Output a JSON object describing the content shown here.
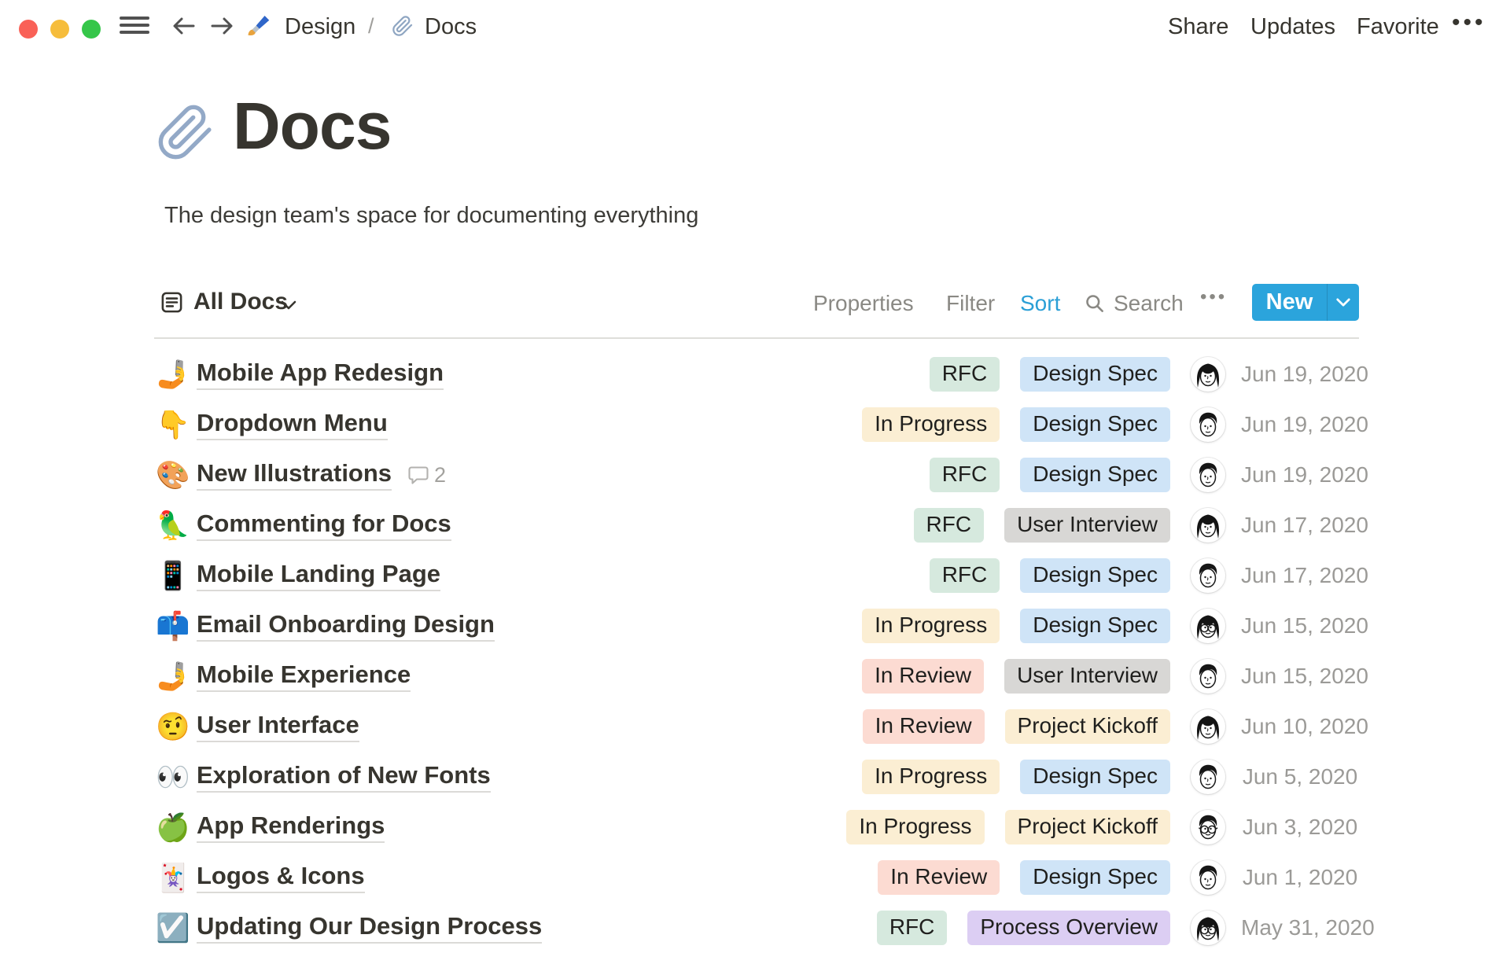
{
  "topbar": {
    "breadcrumb": [
      {
        "icon": "paintbrush-icon",
        "emoji": "🖌️",
        "label": "Design"
      },
      {
        "icon": "paperclip-icon",
        "emoji": "📎",
        "label": "Docs"
      }
    ],
    "separator": "/",
    "actions": [
      "Share",
      "Updates",
      "Favorite"
    ],
    "more_label": "•••"
  },
  "page": {
    "icon": "paperclip-icon",
    "icon_emoji": "📎",
    "title": "Docs",
    "subtitle": "The design team's space for documenting everything"
  },
  "toolbar": {
    "view_icon": "list-view-icon",
    "view_label": "All Docs",
    "properties_label": "Properties",
    "filter_label": "Filter",
    "sort_label": "Sort",
    "active_item": "Sort",
    "search_label": "Search",
    "more_label": "•••",
    "new_label": "New"
  },
  "colors": {
    "accent_blue": "#2BA4DC",
    "tag_green": "#d6e9de",
    "tag_blue": "#cfe4f7",
    "tag_yellow": "#fbeed3",
    "tag_gray": "#d8d7d5",
    "tag_red": "#fcdbd2",
    "tag_purple": "#dccef3"
  },
  "tag_styles": {
    "RFC": "green",
    "In Progress": "yellow",
    "In Review": "red",
    "Design Spec": "blue",
    "User Interview": "gray",
    "Project Kickoff": "yellow",
    "Process Overview": "purple"
  },
  "rows": [
    {
      "emoji": "🤳",
      "title": "Mobile App Redesign",
      "comments": null,
      "status": "RFC",
      "category": "Design Spec",
      "avatar": "woman",
      "date": "Jun 19, 2020"
    },
    {
      "emoji": "👇",
      "title": "Dropdown Menu",
      "comments": null,
      "status": "In Progress",
      "category": "Design Spec",
      "avatar": "man",
      "date": "Jun 19, 2020"
    },
    {
      "emoji": "🎨",
      "title": "New Illustrations",
      "comments": 2,
      "status": "RFC",
      "category": "Design Spec",
      "avatar": "man",
      "date": "Jun 19, 2020"
    },
    {
      "emoji": "🦜",
      "title": "Commenting for Docs",
      "comments": null,
      "status": "RFC",
      "category": "User Interview",
      "avatar": "woman",
      "date": "Jun 17, 2020"
    },
    {
      "emoji": "📱",
      "title": "Mobile Landing Page",
      "comments": null,
      "status": "RFC",
      "category": "Design Spec",
      "avatar": "man",
      "date": "Jun 17, 2020"
    },
    {
      "emoji": "📫",
      "title": "Email Onboarding Design",
      "comments": null,
      "status": "In Progress",
      "category": "Design Spec",
      "avatar": "woman-glasses",
      "date": "Jun 15, 2020"
    },
    {
      "emoji": "🤳",
      "title": "Mobile Experience",
      "comments": null,
      "status": "In Review",
      "category": "User Interview",
      "avatar": "man",
      "date": "Jun 15, 2020"
    },
    {
      "emoji": "🤨",
      "title": "User Interface",
      "comments": null,
      "status": "In Review",
      "category": "Project Kickoff",
      "avatar": "woman",
      "date": "Jun 10, 2020"
    },
    {
      "emoji": "👀",
      "title": "Exploration of New Fonts",
      "comments": null,
      "status": "In Progress",
      "category": "Design Spec",
      "avatar": "man",
      "date": "Jun 5, 2020"
    },
    {
      "emoji": "🍏",
      "title": "App Renderings",
      "comments": null,
      "status": "In Progress",
      "category": "Project Kickoff",
      "avatar": "man-glasses",
      "date": "Jun 3, 2020"
    },
    {
      "emoji": "🃏",
      "title": "Logos & Icons",
      "comments": null,
      "status": "In Review",
      "category": "Design Spec",
      "avatar": "man",
      "date": "Jun 1, 2020"
    },
    {
      "emoji": "☑️",
      "title": "Updating Our Design Process",
      "comments": null,
      "status": "RFC",
      "category": "Process Overview",
      "avatar": "woman-glasses",
      "date": "May 31, 2020"
    }
  ]
}
